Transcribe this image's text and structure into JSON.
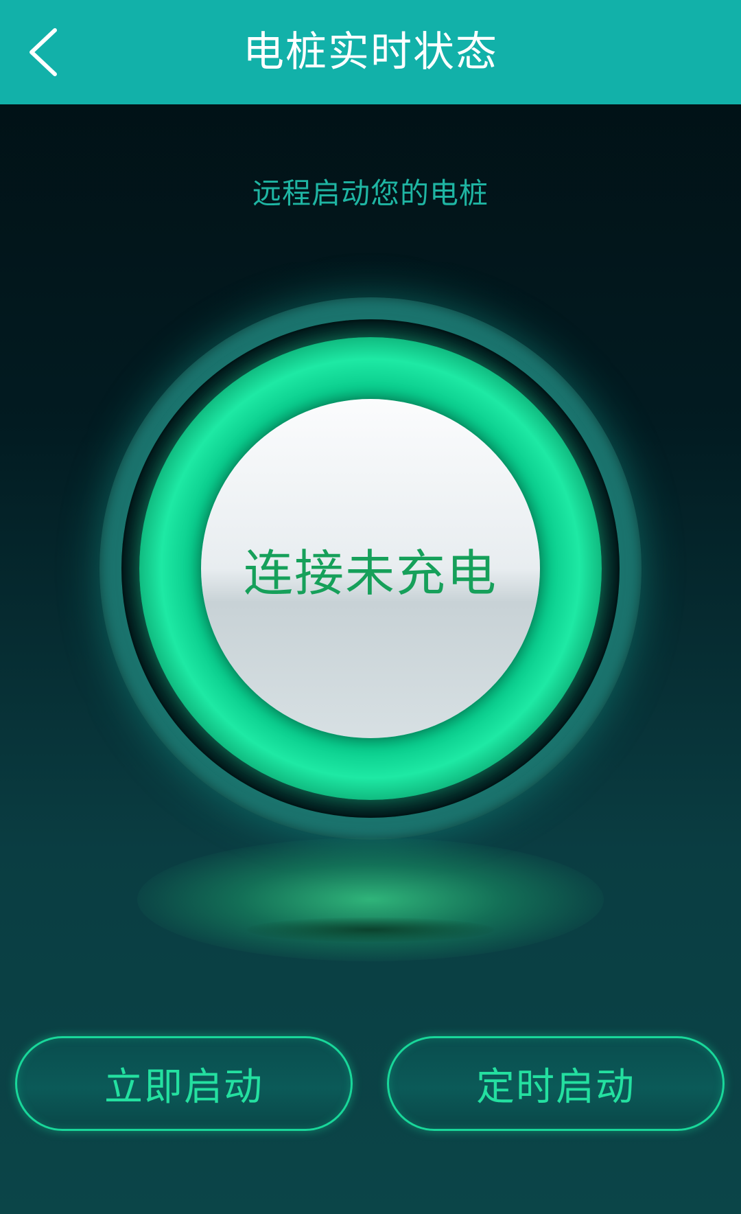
{
  "header": {
    "title": "电桩实时状态",
    "back_icon": "chevron-left-icon"
  },
  "main": {
    "subtitle": "远程启动您的电桩",
    "status": "连接未充电"
  },
  "actions": {
    "start_now_label": "立即启动",
    "scheduled_start_label": "定时启动"
  },
  "colors": {
    "header_bg": "#12b1a9",
    "accent_green": "#1ee9a4",
    "status_text": "#16a05a",
    "subtitle_text": "#1fb5a3"
  }
}
